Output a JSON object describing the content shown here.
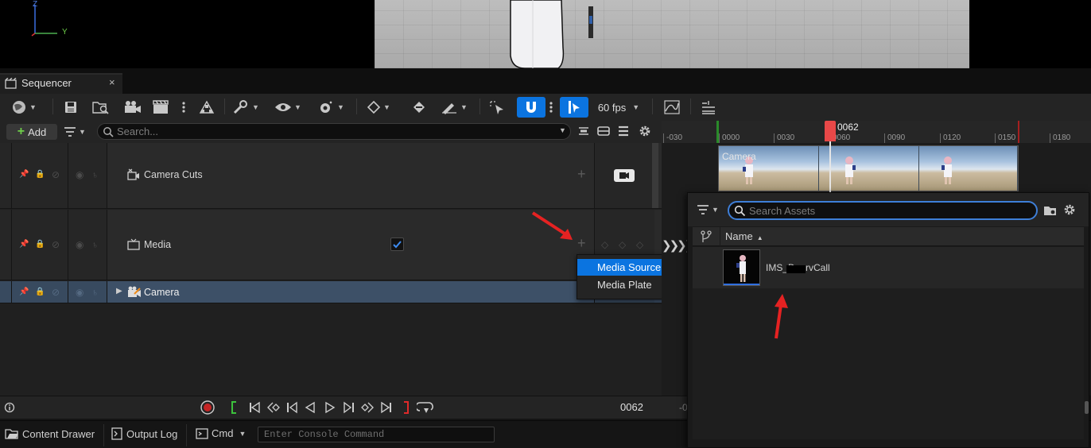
{
  "viewport": {
    "axis_z": "Z",
    "axis_y": "Y"
  },
  "tab": {
    "title": "Sequencer",
    "close": "×"
  },
  "toolbar": {
    "fps": "60 fps"
  },
  "search_row": {
    "add_label": "Add",
    "search_placeholder": "Search..."
  },
  "tracks": [
    {
      "name": "Camera Cuts"
    },
    {
      "name": "Media",
      "checked": true
    },
    {
      "name": "Camera",
      "selected": true
    }
  ],
  "context_menu": {
    "items": [
      {
        "label": "Media Source",
        "highlighted": true
      },
      {
        "label": "Media Plate",
        "highlighted": false
      }
    ]
  },
  "timeline": {
    "ticks": [
      "-030",
      "0000",
      "0030",
      "0060",
      "0090",
      "0120",
      "0150",
      "0180"
    ],
    "playhead": "0062",
    "camera_strip_label": "Camera"
  },
  "playback": {
    "frame": "0062",
    "secondary_frame": "-0"
  },
  "bottom_bar": {
    "content_drawer": "Content Drawer",
    "output_log": "Output Log",
    "cmd": "Cmd",
    "console_placeholder": "Enter Console Command"
  },
  "asset_picker": {
    "search_placeholder": "Search Assets",
    "column_name": "Name",
    "assets": [
      {
        "name": "IMS_DoorvCall"
      }
    ]
  },
  "colors": {
    "accent": "#0b74e0",
    "selected_track": "#3d5067",
    "playhead": "#e84848",
    "annotation_arrow": "#e52222"
  }
}
